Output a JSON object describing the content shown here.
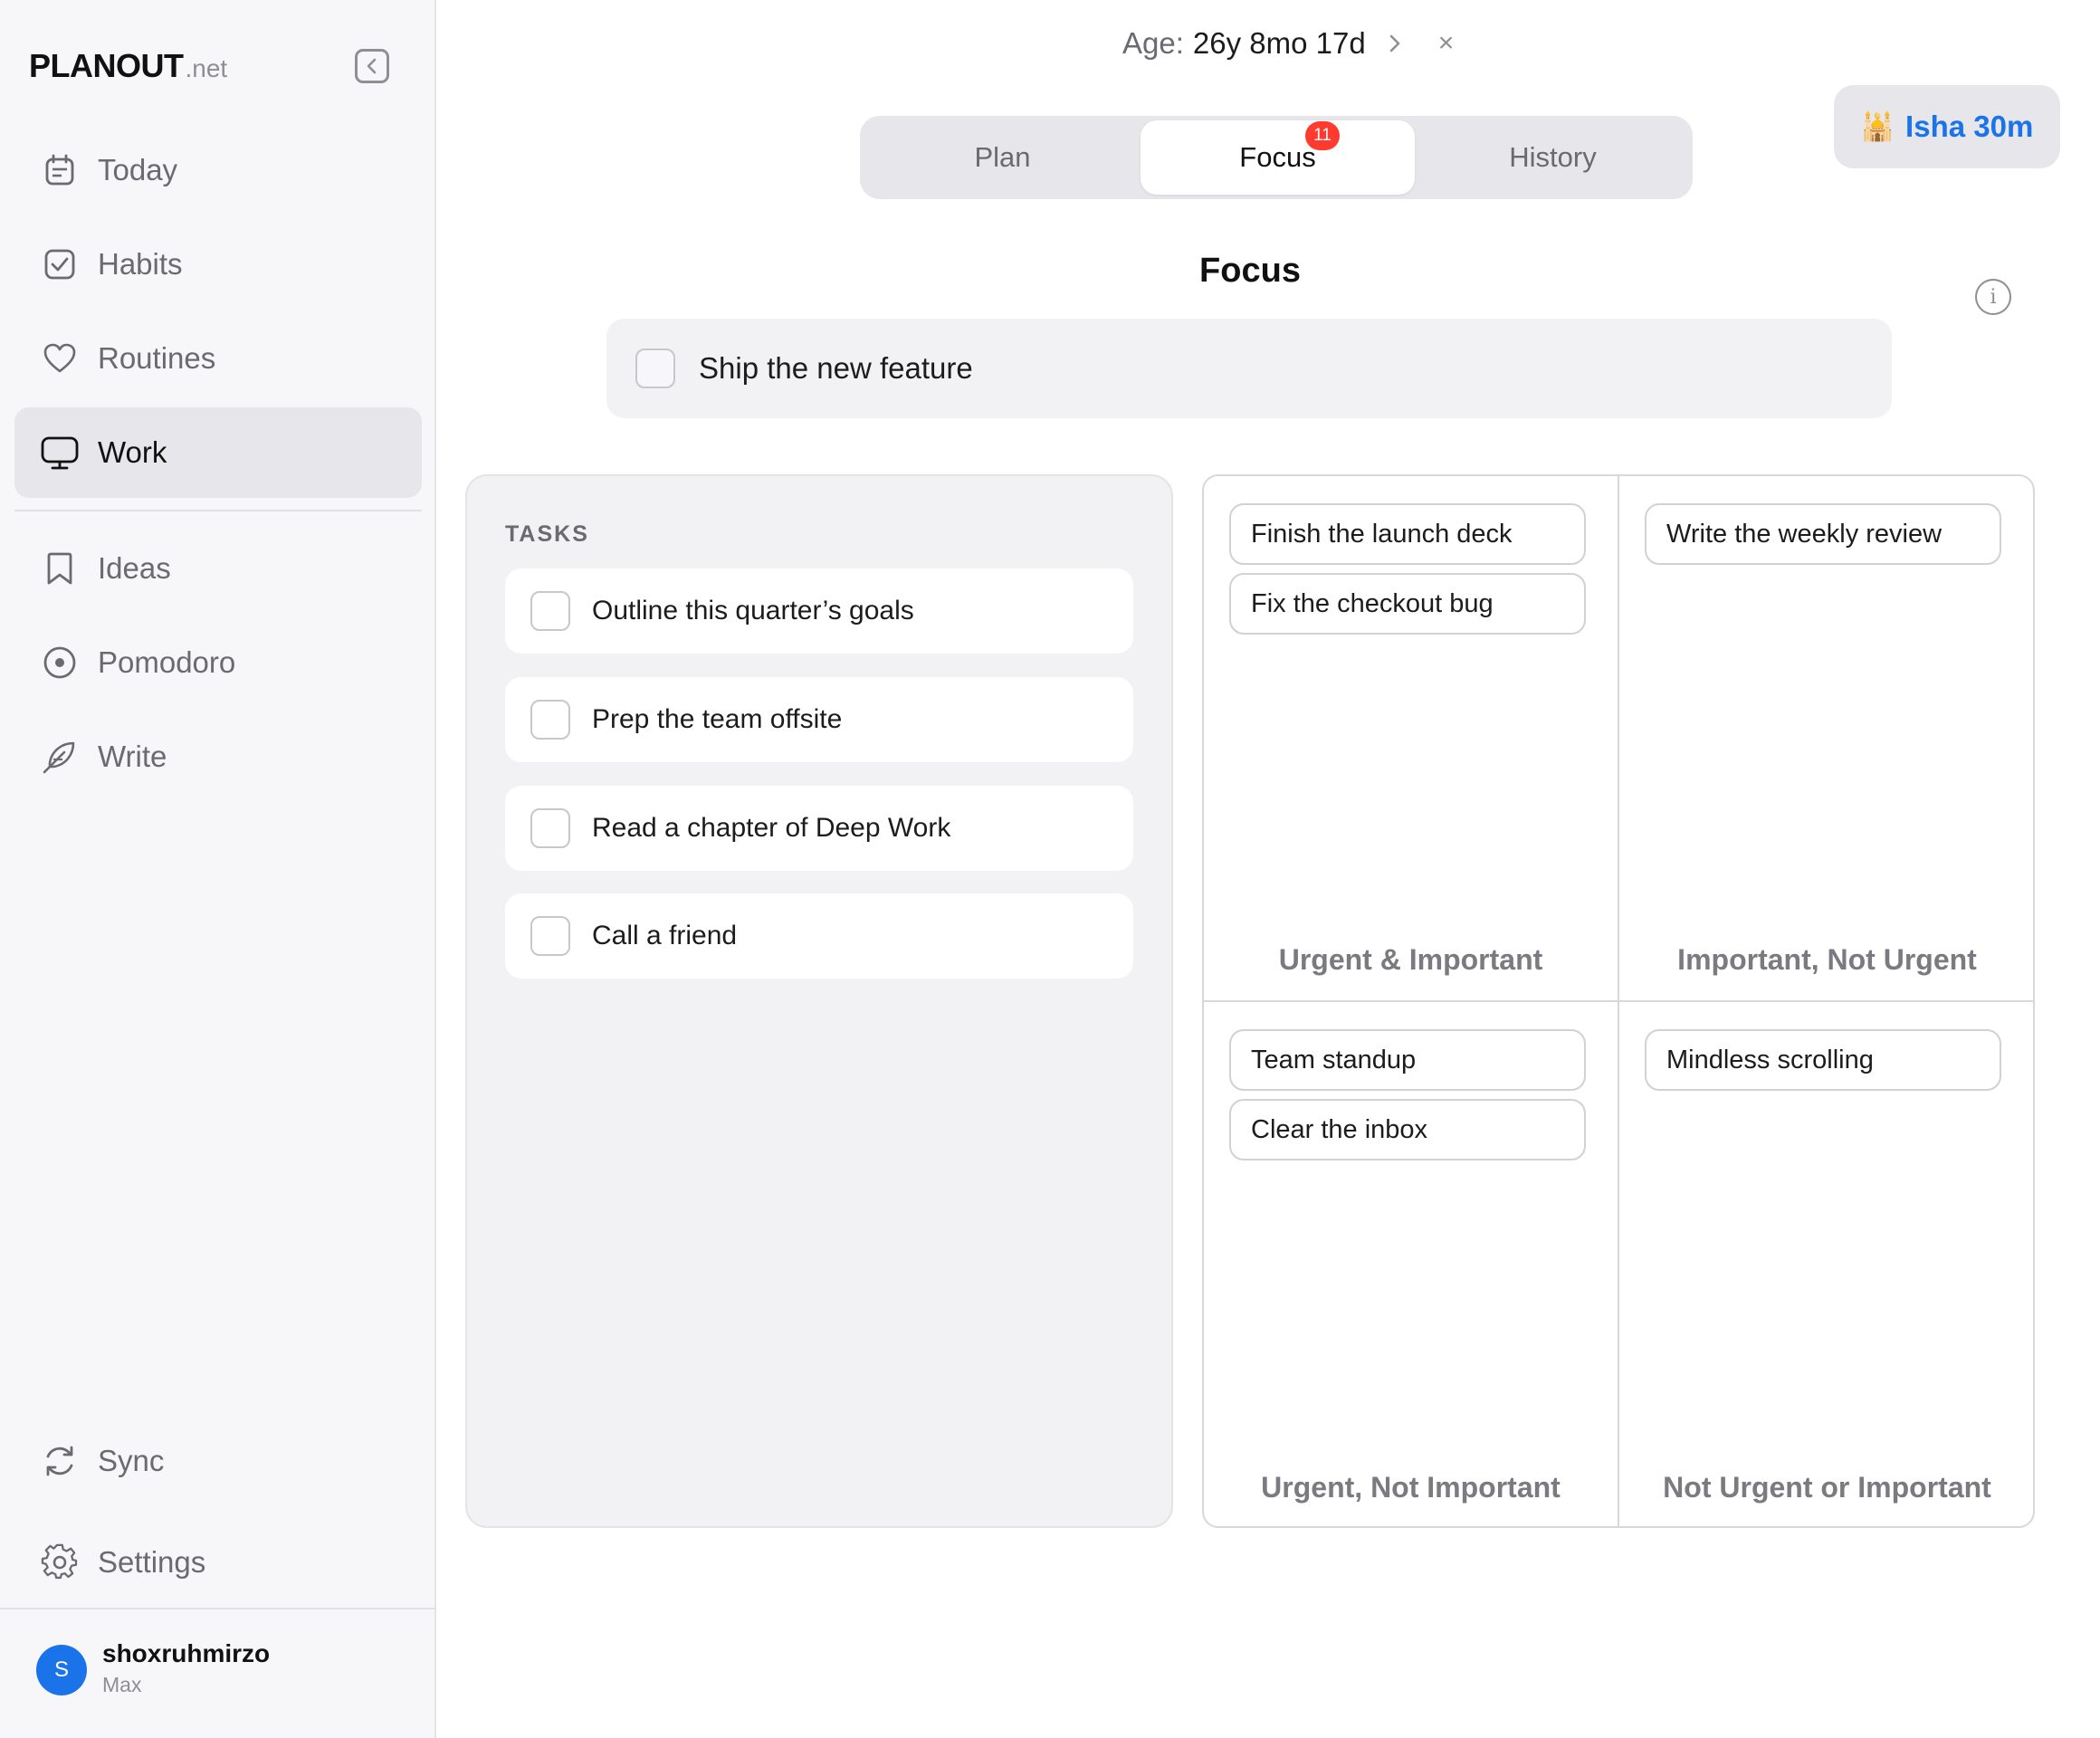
{
  "sidebar": {
    "brand": {
      "name": "PLANOUT",
      "suffix": ".net"
    },
    "nav_primary": [
      {
        "label": "Today",
        "icon": "calendar-icon",
        "active": false
      },
      {
        "label": "Habits",
        "icon": "checkbox-icon",
        "active": false
      },
      {
        "label": "Routines",
        "icon": "heart-icon",
        "active": false
      },
      {
        "label": "Work",
        "icon": "monitor-icon",
        "active": true
      }
    ],
    "nav_secondary": [
      {
        "label": "Ideas",
        "icon": "bookmark-icon"
      },
      {
        "label": "Pomodoro",
        "icon": "target-icon"
      },
      {
        "label": "Write",
        "icon": "feather-icon"
      }
    ],
    "nav_bottom": [
      {
        "label": "Sync",
        "icon": "sync-icon"
      },
      {
        "label": "Settings",
        "icon": "gear-icon"
      }
    ],
    "user": {
      "initial": "S",
      "name": "shoxruhmirzo",
      "plan": "Max"
    }
  },
  "top": {
    "age_prefix": "Age:",
    "age_value": "26y 8mo 17d",
    "close_glyph": "×",
    "tabs": [
      {
        "label": "Plan",
        "active": false
      },
      {
        "label": "Focus",
        "active": true,
        "badge": "11"
      },
      {
        "label": "History",
        "active": false
      }
    ],
    "prayer": {
      "icon": "🕌",
      "label": "Isha 30m"
    }
  },
  "focus": {
    "title": "Focus",
    "info_glyph": "i",
    "item": "Ship the new feature"
  },
  "tasks": {
    "heading": "TASKS",
    "items": [
      "Outline this quarter’s goals",
      "Prep the team offsite",
      "Read a chapter of Deep Work",
      "Call a friend"
    ]
  },
  "matrix": {
    "quadrants": [
      {
        "label": "Urgent & Important",
        "items": [
          "Finish the launch deck",
          "Fix the checkout bug"
        ]
      },
      {
        "label": "Important, Not Urgent",
        "items": [
          "Write the weekly review"
        ]
      },
      {
        "label": "Urgent, Not Important",
        "items": [
          "Team standup",
          "Clear the inbox"
        ]
      },
      {
        "label": "Not Urgent or Important",
        "items": [
          "Mindless scrolling"
        ]
      }
    ]
  },
  "colors": {
    "accent": "#1a73e8",
    "badge": "#ff3b30",
    "sidebar_bg": "#f7f7f9",
    "active_bg": "#e6e6eb"
  }
}
